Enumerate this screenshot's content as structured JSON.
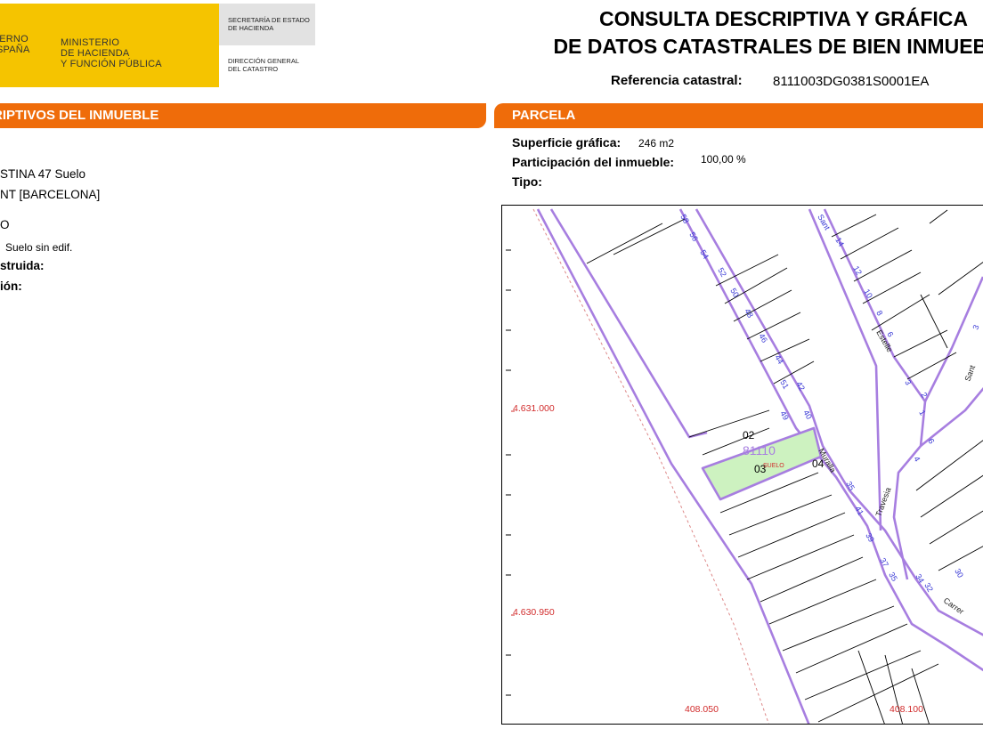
{
  "header": {
    "gobierno": "IERNO\nSPAÑA",
    "ministerio": "MINISTERIO\nDE HACIENDA\nY FUNCIÓN PÚBLICA",
    "secretaria": "SECRETARÍA DE ESTADO\nDE HACIENDA",
    "direccion": "DIRECCIÓN GENERAL\nDEL CATASTRO",
    "title_line1": "CONSULTA DESCRIPTIVA Y GRÁFICA",
    "title_line2": "DE DATOS CATASTRALES DE BIEN INMUEBLE",
    "ref_label": "Referencia catastral:",
    "ref_value": "8111003DG0381S0001EA"
  },
  "left_section": {
    "title_prefix": "RIPTIVOS DEL ",
    "title_bold": "INMUEBLE",
    "lines": [
      {
        "text": "STINA 47 Suelo",
        "bold": false
      },
      {
        "text": "NT [BARCELONA]",
        "bold": false
      },
      {
        "text": "O",
        "bold": false
      },
      {
        "text": "Suelo sin edif.",
        "bold": false
      },
      {
        "text": "struida:",
        "bold": true
      },
      {
        "text": "ión:",
        "bold": true
      }
    ]
  },
  "parcela": {
    "title": "PARCELA",
    "superficie_label": "Superficie gráfica:",
    "superficie_value": "246 m2",
    "participacion_label": "Participación del inmueble:",
    "participacion_value": "100,00 %",
    "tipo_label": "Tipo:"
  },
  "map": {
    "coord_y1": "4.631.000",
    "coord_y2": "4.630.950",
    "coord_x1": "408.050",
    "coord_x2": "408.100",
    "parcel_id": "81110",
    "suelo": "SUELO",
    "plot_02": "02",
    "plot_03": "03",
    "plot_04": "04",
    "street_muralla": "Muralla",
    "street_travesia": "Travesia",
    "street_estelle": "Estelle",
    "street_sant": "Sant",
    "street_sant2": "Sant",
    "street_carrer": "Carrer",
    "colors": {
      "line": "#a77ee0",
      "parcel": "#cdf2c0",
      "coord": "#d12b2b"
    }
  }
}
